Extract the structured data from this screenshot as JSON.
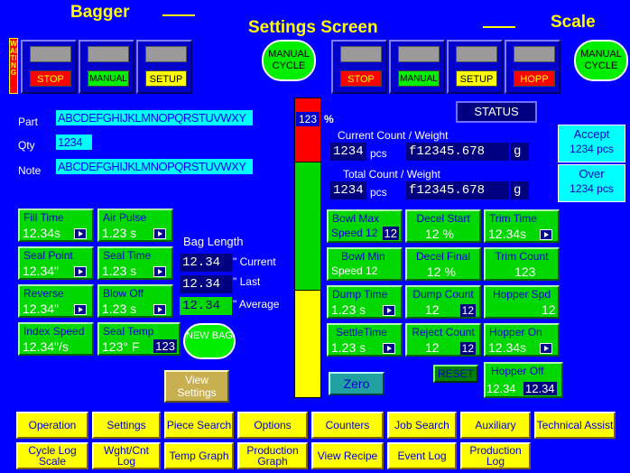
{
  "header": {
    "left": "Bagger",
    "center": "Settings Screen",
    "right": "Scale"
  },
  "waiting": "WAITING",
  "bagger_buttons": [
    {
      "label": "STOP"
    },
    {
      "label": "MANUAL"
    },
    {
      "label": "SETUP"
    }
  ],
  "scale_buttons": [
    {
      "label": "STOP"
    },
    {
      "label": "MANUAL"
    },
    {
      "label": "SETUP"
    },
    {
      "label": "HOPP"
    }
  ],
  "manual_cycle": "MANUAL CYCLE",
  "info": {
    "part_label": "Part",
    "part_value": "ABCDEFGHIJKLMNOPQRSTUVWXY",
    "qty_label": "Qty",
    "qty_value": "1234",
    "note_label": "Note",
    "note_value": "ABCDEFGHIJKLMNOPQRSTUVWXY"
  },
  "level": {
    "percent": "123",
    "unit": "%"
  },
  "status_button": "STATUS",
  "current": {
    "title": "Current Count / Weight",
    "count": "1234",
    "count_unit": "pcs",
    "weight": "f12345.678",
    "weight_unit": "g"
  },
  "total": {
    "title": "Total Count / Weight",
    "count": "1234",
    "count_unit": "pcs",
    "weight": "f12345.678",
    "weight_unit": "g"
  },
  "accept": {
    "label": "Accept",
    "value": "1234 pcs"
  },
  "over": {
    "label": "Over",
    "value": "1234 pcs"
  },
  "bagger_settings": [
    {
      "label": "Fill Time",
      "value": "12.34s"
    },
    {
      "label": "Air Pulse",
      "value": "1.23 s"
    },
    {
      "label": "Seal Point",
      "value": "12.34\""
    },
    {
      "label": "Seal Time",
      "value": "1.23 s"
    },
    {
      "label": "Reverse",
      "value": "12.34\""
    },
    {
      "label": "Blow Off",
      "value": "1.23 s"
    },
    {
      "label": "Index Speed",
      "value": "12.34\"/s"
    },
    {
      "label": "Seal Temp",
      "value": "123° F",
      "extra": "123"
    }
  ],
  "bag_length": {
    "title": "Bag Length",
    "current_value": "12.34",
    "current_label": "\" Current",
    "last_value": "12.34",
    "last_label": "\" Last",
    "avg_value": "12.34",
    "avg_label": "\" Average"
  },
  "new_bag": "NEW BAG",
  "view_settings": "View Settings",
  "scale_settings": [
    {
      "label": "Bowl Max",
      "value": "Speed 12",
      "extra": "12"
    },
    {
      "label": "Decel Start",
      "value": "12  %"
    },
    {
      "label": "Trim Time",
      "value": "12.34s"
    },
    {
      "label": "Bowl Min",
      "value": "Speed  12"
    },
    {
      "label": "Decel Final",
      "value": "12 %"
    },
    {
      "label": "Trim Count",
      "value": "123"
    },
    {
      "label": "Dump Time",
      "value": "1.23 s"
    },
    {
      "label": "Dump Count",
      "value": "12",
      "extra": "12"
    },
    {
      "label": "Hopper Spd",
      "value": "12"
    },
    {
      "label": "SettleTime",
      "value": "1.23 s"
    },
    {
      "label": "Reject Count",
      "value": "12",
      "extra": "12"
    },
    {
      "label": "Hopper On",
      "value": "12.34s"
    }
  ],
  "hopper_off": {
    "label": "Hopper Off",
    "value": "12.34",
    "extra": "12.34"
  },
  "zero": "Zero",
  "reset": "RESET",
  "nav_row1": [
    "Operation",
    "Settings",
    "Piece Search",
    "Options",
    "Counters",
    "Job Search",
    "Auxiliary",
    "Technical Assist"
  ],
  "nav_row2": [
    "Cycle Log Scale",
    "Wght/Cnt Log",
    "Temp Graph",
    "Production Graph",
    "View Recipe",
    "Event Log",
    "Production Log"
  ],
  "colors": {
    "bg": "#0000ff",
    "title": "#ffff00",
    "green": "#00d800",
    "cyan": "#00ffff",
    "red": "#ff0000",
    "yellow": "#ffff00"
  },
  "hopper_level": {
    "red_fraction": 0.21,
    "green_fraction": 0.43,
    "yellow_fraction": 0.36
  }
}
